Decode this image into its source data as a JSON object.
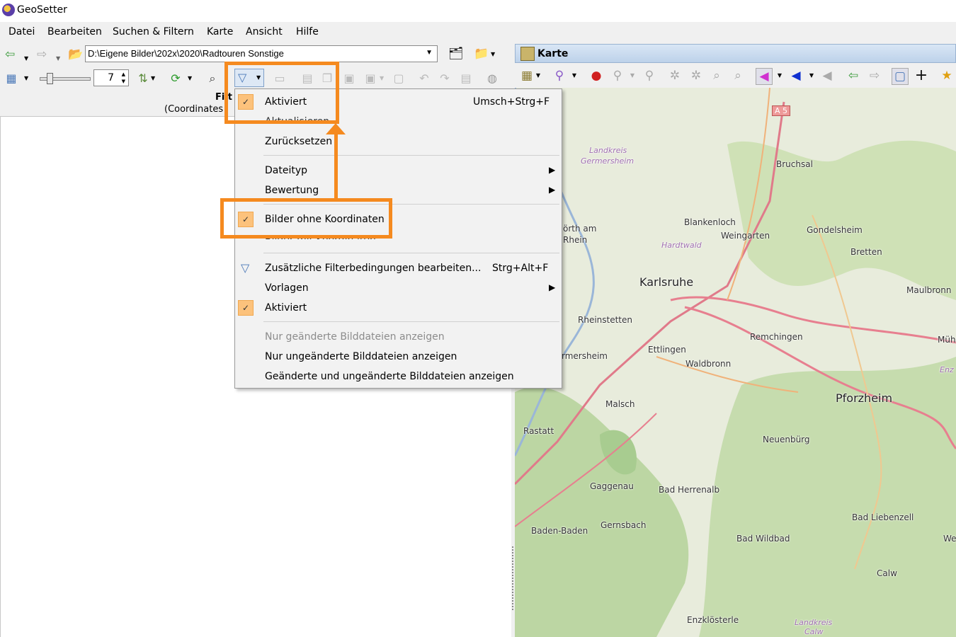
{
  "window": {
    "title": "GeoSetter"
  },
  "menubar": [
    "Datei",
    "Bearbeiten",
    "Suchen & Filtern",
    "Karte",
    "Ansicht",
    "Hilfe"
  ],
  "pathbar": {
    "path": "D:\\Eigene Bilder\\202x\\2020\\Radtouren Sonstige"
  },
  "toolbar2": {
    "thumb_size_value": "7"
  },
  "left_panel": {
    "header_title": "Filt",
    "header_subtitle": "(Coordinates"
  },
  "map_panel": {
    "title": "Karte",
    "places": [
      {
        "name": "A 5",
        "kind": "highway"
      },
      {
        "name": "Landkreis",
        "kind": "region"
      },
      {
        "name": "Germersheim",
        "kind": "region"
      },
      {
        "name": "Bruchsal",
        "kind": "town"
      },
      {
        "name": "Blankenloch",
        "kind": "town"
      },
      {
        "name": "Weingarten",
        "kind": "town"
      },
      {
        "name": "Gondelsheim",
        "kind": "town"
      },
      {
        "name": "Bretten",
        "kind": "town"
      },
      {
        "name": "Hardtwald",
        "kind": "region"
      },
      {
        "name": "örth am",
        "kind": "town"
      },
      {
        "name": "Rhein",
        "kind": "town"
      },
      {
        "name": "Karlsruhe",
        "kind": "city"
      },
      {
        "name": "Maulbronn",
        "kind": "town"
      },
      {
        "name": "Rheinstetten",
        "kind": "town"
      },
      {
        "name": "Remchingen",
        "kind": "town"
      },
      {
        "name": "Müh",
        "kind": "town"
      },
      {
        "name": "Ettlingen",
        "kind": "town"
      },
      {
        "name": "rmersheim",
        "kind": "town"
      },
      {
        "name": "Waldbronn",
        "kind": "town"
      },
      {
        "name": "Enz",
        "kind": "region"
      },
      {
        "name": "Pforzheim",
        "kind": "city"
      },
      {
        "name": "Malsch",
        "kind": "town"
      },
      {
        "name": "Rastatt",
        "kind": "town"
      },
      {
        "name": "Neuenbürg",
        "kind": "town"
      },
      {
        "name": "Gaggenau",
        "kind": "town"
      },
      {
        "name": "Bad Herrenalb",
        "kind": "town"
      },
      {
        "name": "Baden-Baden",
        "kind": "town"
      },
      {
        "name": "Gernsbach",
        "kind": "town"
      },
      {
        "name": "Bad Liebenzell",
        "kind": "town"
      },
      {
        "name": "Bad Wildbad",
        "kind": "town"
      },
      {
        "name": "We",
        "kind": "town"
      },
      {
        "name": "Calw",
        "kind": "town"
      },
      {
        "name": "Enzklösterle",
        "kind": "town"
      },
      {
        "name": "Landkreis",
        "kind": "region"
      },
      {
        "name": "Calw",
        "kind": "region"
      }
    ]
  },
  "dropdown": {
    "items": [
      {
        "label": "Aktiviert",
        "shortcut": "Umsch+Strg+F",
        "checked": true
      },
      {
        "label": "Zurücksetzen"
      },
      {
        "label": "Dateityp",
        "submenu": true
      },
      {
        "label": "Bewertung",
        "submenu": true
      },
      {
        "label": "Bilder ohne Koordinaten",
        "checked": true
      },
      {
        "label": "Zusätzliche Filterbedingungen bearbeiten...",
        "shortcut": "Strg+Alt+F",
        "icon": "funnel-icon"
      },
      {
        "label": "Vorlagen",
        "submenu": true
      },
      {
        "label": "Aktiviert",
        "checked": true
      },
      {
        "label": "Nur geänderte Bilddateien anzeigen",
        "disabled": true
      },
      {
        "label": "Nur ungeänderte Bilddateien anzeigen"
      },
      {
        "label": "Geänderte und ungeänderte Bilddateien anzeigen"
      }
    ],
    "obscured": [
      "Aktualisieren",
      "Bilder mit Koordinaten"
    ]
  },
  "colors": {
    "highlight": "#f58a1f",
    "check_bg": "#fcc27c",
    "map_green": "#c8dcb0",
    "map_road": "#e77f8f"
  }
}
